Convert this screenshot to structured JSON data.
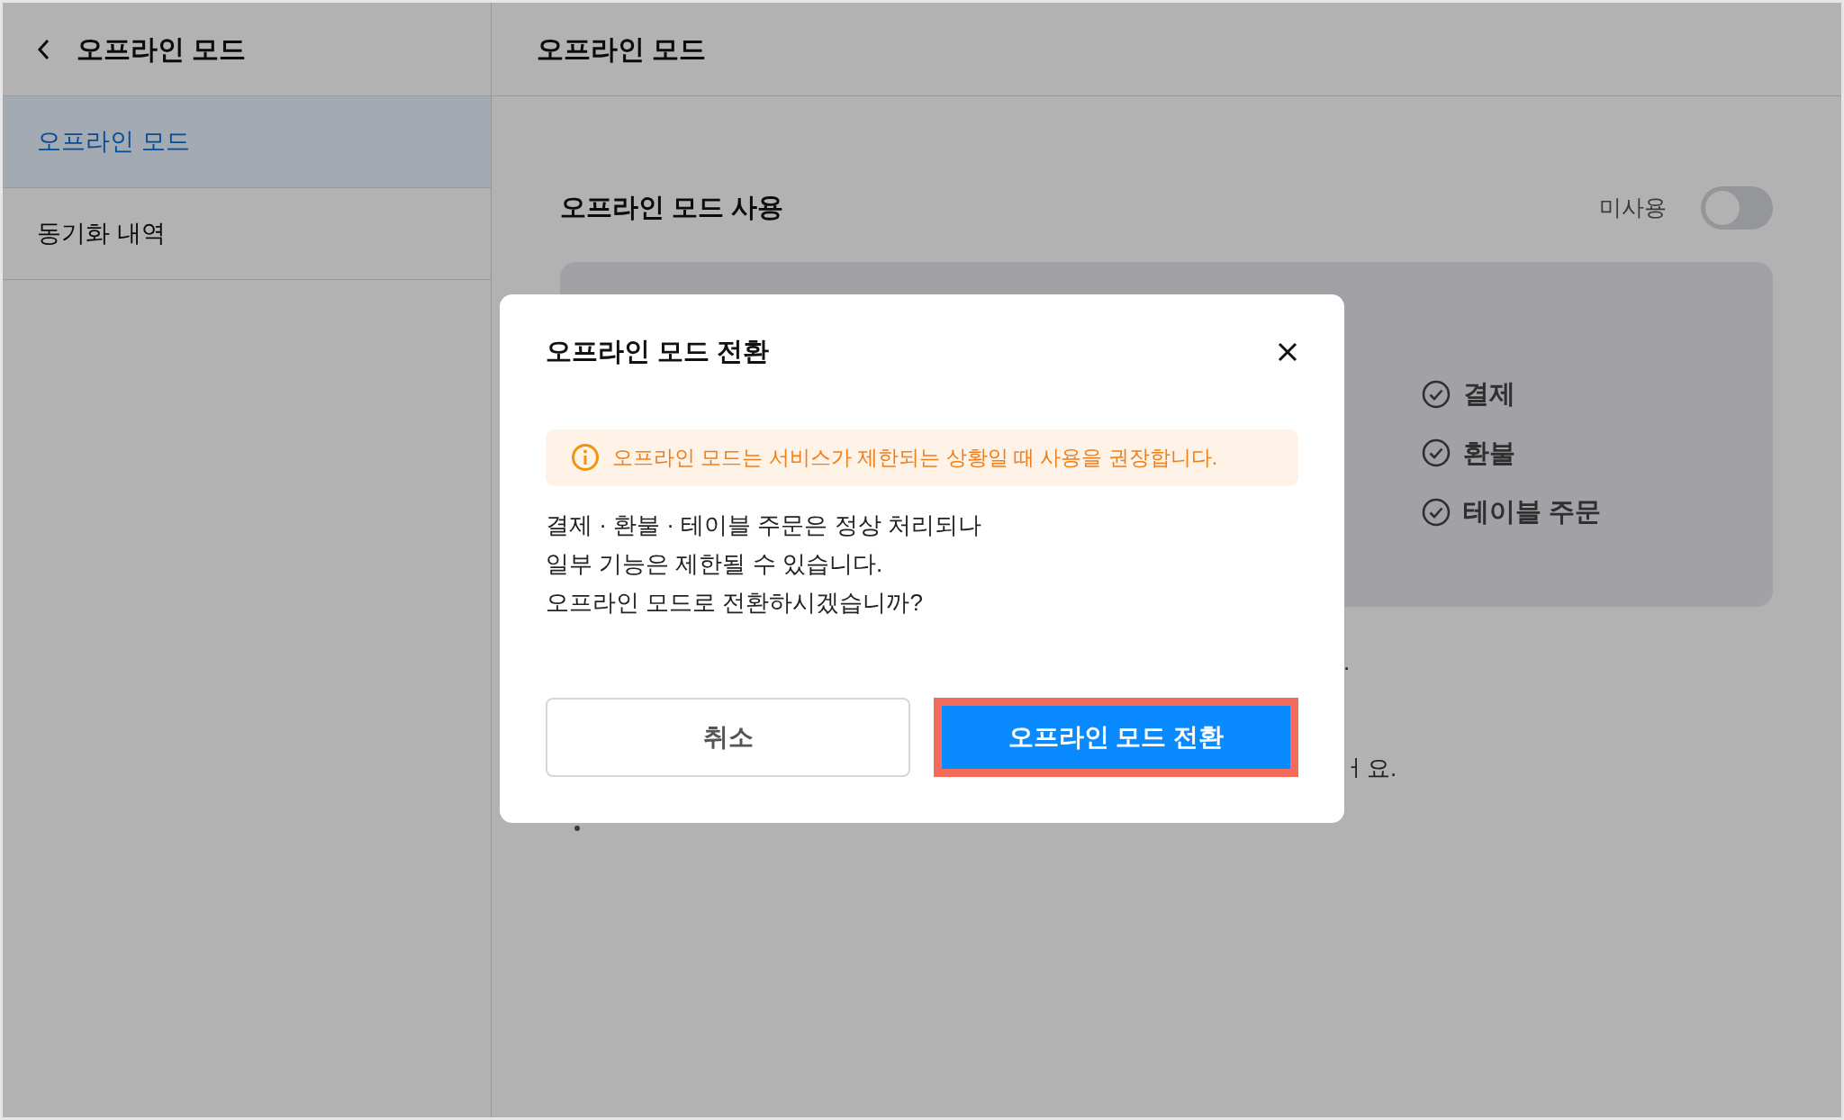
{
  "sidebar": {
    "title": "오프라인 모드",
    "items": [
      {
        "label": "오프라인 모드",
        "selected": true
      },
      {
        "label": "동기화 내역",
        "selected": false
      }
    ]
  },
  "main": {
    "title": "오프라인 모드",
    "setting": {
      "label": "오프라인 모드 사용",
      "toggle_label": "미사용",
      "on": false
    },
    "features": [
      "결제",
      "환불",
      "테이블 주문"
    ],
    "partial_texts": [
      ".",
      "ㅓ요."
    ]
  },
  "dialog": {
    "title": "오프라인 모드 전환",
    "alert": "오프라인 모드는 서비스가 제한되는 상황일 때 사용을 권장합니다.",
    "body": [
      "결제 · 환불 · 테이블 주문은 정상 처리되나",
      "일부 기능은 제한될 수 있습니다.",
      "오프라인 모드로 전환하시겠습니까?"
    ],
    "buttons": [
      {
        "label": "취소",
        "kind": "secondary",
        "highlighted": false
      },
      {
        "label": "오프라인 모드 전환",
        "kind": "primary",
        "highlighted": true
      }
    ]
  }
}
